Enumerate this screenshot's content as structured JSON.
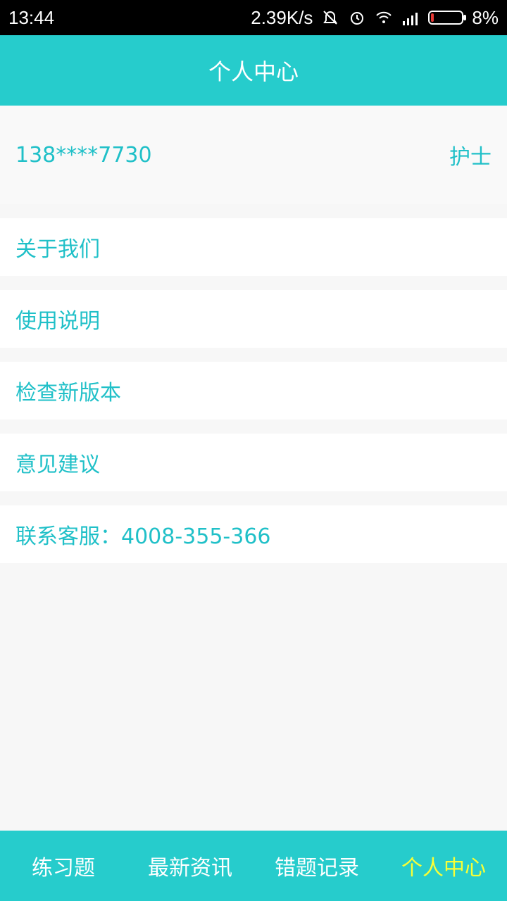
{
  "status_bar": {
    "time": "13:44",
    "speed": "2.39K/s",
    "battery": "8%",
    "icons": [
      "mute-icon",
      "alarm-icon",
      "wifi-icon",
      "signal-icon",
      "battery-icon"
    ]
  },
  "header": {
    "title": "个人中心"
  },
  "account": {
    "phone": "138****7730",
    "role": "护士"
  },
  "menu": {
    "items": [
      {
        "label": "关于我们"
      },
      {
        "label": "使用说明"
      },
      {
        "label": "检查新版本"
      },
      {
        "label": "意见建议"
      },
      {
        "label": "联系客服：4008-355-366"
      }
    ]
  },
  "bottom_nav": {
    "items": [
      {
        "label": "练习题"
      },
      {
        "label": "最新资讯"
      },
      {
        "label": "错题记录"
      },
      {
        "label": "个人中心"
      }
    ],
    "active_index": 3
  },
  "colors": {
    "accent": "#26cccc",
    "text_accent": "#20c0c8",
    "active_nav": "#f8ff36"
  }
}
